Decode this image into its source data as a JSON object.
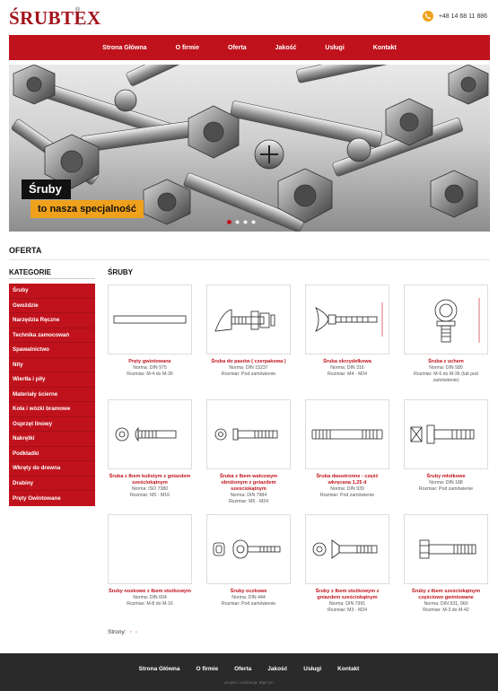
{
  "brand": {
    "logo": "ŚRUBTEX",
    "registered": "®",
    "suffix": "Sp. z o.o."
  },
  "header": {
    "phone": "+48 14 68 11 886",
    "phone_icon": "phone-icon"
  },
  "nav": {
    "items": [
      "Strona Główna",
      "O firmie",
      "Oferta",
      "Jakość",
      "Usługi",
      "Kontakt"
    ]
  },
  "banner": {
    "line1": "Śruby",
    "line2": "to nasza specjalność",
    "slides": 4,
    "active_slide": 1
  },
  "section": {
    "title": "OFERTA"
  },
  "sidebar": {
    "title": "KATEGORIE",
    "items": [
      "Śruby",
      "Gwoździe",
      "Narzędzia Ręczne",
      "Technika zamocowań",
      "Spawalnictwo",
      "Nity",
      "Wiertła i piły",
      "Materiały ścierne",
      "Koła i wózki bramowe",
      "Osprzęt linowy",
      "Nakrętki",
      "Podkładki",
      "Wkręty do drewna",
      "Drabiny",
      "Pręty Gwintowane"
    ]
  },
  "products": {
    "title": "ŚRUBY",
    "items": [
      {
        "name": "Pręty gwintowane",
        "meta": [
          "Norma: DIN 975",
          "Rozmiar: M-4 do M-36"
        ],
        "icon": "threaded-rod"
      },
      {
        "name": "Śruba do pasów ( czerpakowa )",
        "meta": [
          "Norma: DIN 15237",
          "Rozmiar: Pod zamówienie"
        ],
        "icon": "elevator-bolt"
      },
      {
        "name": "Śruba skrzydełkowa",
        "meta": [
          "Norma: DIN 316",
          "Rozmiar: M4 - M24"
        ],
        "icon": "wing-screw"
      },
      {
        "name": "Śruba z uchem",
        "meta": [
          "Norma: DIN 580",
          "Rozmiar: M-6 do M-36 (lub pod zamówienie)"
        ],
        "icon": "eye-bolt"
      },
      {
        "name": "Śruba z łbem kulistym z gniazdem sześciokątnym",
        "meta": [
          "Norma: ISO 7380",
          "Rozmiar: M5 - M16"
        ],
        "icon": "button-head-bolt"
      },
      {
        "name": "Śruba z łbem walcowym obniżonym z gniazdem sześciokątnym",
        "meta": [
          "Norma: DIN 7984",
          "Rozmiar: M5 - M24"
        ],
        "icon": "low-head-bolt"
      },
      {
        "name": "Śruba dwustronne - część wkręcana 1,25 d",
        "meta": [
          "Norma: DIN 939",
          "Rozmiar: Pod zamówienie"
        ],
        "icon": "stud-bolt"
      },
      {
        "name": "Śruby młotkowe",
        "meta": [
          "Norma: DIN 188",
          "Rozmiar: Pod zamówienie"
        ],
        "icon": "hammer-head-bolt"
      },
      {
        "name": "Śruby noskowe z łbem stożkowym",
        "meta": [
          "Norma: DIN 604",
          "Rozmiar: M-8 do M-16"
        ],
        "icon": "blank"
      },
      {
        "name": "Śruby oczkowe",
        "meta": [
          "Norma: DIN 444",
          "Rozmiar: Pod zamówienie"
        ],
        "icon": "eye-screw"
      },
      {
        "name": "Śruby z łbem stożkowym z gniazdem sześciokątnym",
        "meta": [
          "Norma: DIN 7991",
          "Rozmiar: M3 - M24"
        ],
        "icon": "countersunk-bolt"
      },
      {
        "name": "Śruby z łbem sześciokątnym częściowo gwintowane",
        "meta": [
          "Norma: DIN 931, 960",
          "Rozmiar: M-3 do M-42"
        ],
        "icon": "hex-bolt"
      }
    ]
  },
  "pagination": {
    "label": "Strony:",
    "pages": [
      "◦",
      "›"
    ]
  },
  "footer": {
    "items": [
      "Strona Główna",
      "O firmie",
      "Oferta",
      "Jakość",
      "Usługi",
      "Kontakt"
    ],
    "credit": "projekt i realizacja: BigCom"
  },
  "colors": {
    "accent": "#c0121c",
    "highlight": "#f0a11c",
    "footer": "#2a2a2a"
  }
}
